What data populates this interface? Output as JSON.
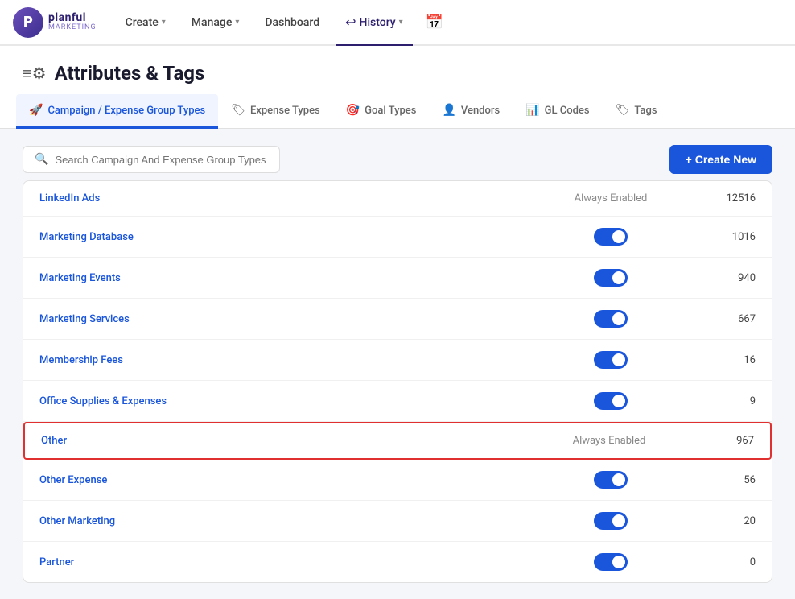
{
  "logo": {
    "initial": "P",
    "name": "planful",
    "sub": "MARKETING"
  },
  "nav": {
    "items": [
      {
        "label": "Create",
        "hasDropdown": true,
        "active": false
      },
      {
        "label": "Manage",
        "hasDropdown": true,
        "active": false
      },
      {
        "label": "Dashboard",
        "hasDropdown": false,
        "active": false
      },
      {
        "label": "History",
        "hasDropdown": true,
        "active": true
      }
    ]
  },
  "page_header": {
    "title": "Attributes & Tags",
    "icon": "⚙"
  },
  "tabs": [
    {
      "id": "campaign",
      "label": "Campaign / Expense Group Types",
      "icon": "🚀",
      "active": true
    },
    {
      "id": "expense",
      "label": "Expense Types",
      "icon": "🏷",
      "active": false
    },
    {
      "id": "goal",
      "label": "Goal Types",
      "icon": "🎯",
      "active": false
    },
    {
      "id": "vendors",
      "label": "Vendors",
      "icon": "👤",
      "active": false
    },
    {
      "id": "gl",
      "label": "GL Codes",
      "icon": "📊",
      "active": false
    },
    {
      "id": "tags",
      "label": "Tags",
      "icon": "🏷",
      "active": false
    }
  ],
  "toolbar": {
    "search_placeholder": "Search Campaign And Expense Group Types",
    "create_label": "+ Create New"
  },
  "table_rows": [
    {
      "name": "LinkedIn Ads",
      "status": "Always Enabled",
      "toggle": null,
      "count": "12516"
    },
    {
      "name": "Marketing Database",
      "status": null,
      "toggle": true,
      "count": "1016"
    },
    {
      "name": "Marketing Events",
      "status": null,
      "toggle": true,
      "count": "940"
    },
    {
      "name": "Marketing Services",
      "status": null,
      "toggle": true,
      "count": "667"
    },
    {
      "name": "Membership Fees",
      "status": null,
      "toggle": true,
      "count": "16"
    },
    {
      "name": "Office Supplies & Expenses",
      "status": null,
      "toggle": true,
      "count": "9"
    },
    {
      "name": "Other",
      "status": "Always Enabled",
      "toggle": null,
      "count": "967",
      "highlighted": true
    },
    {
      "name": "Other Expense",
      "status": null,
      "toggle": true,
      "count": "56"
    },
    {
      "name": "Other Marketing",
      "status": null,
      "toggle": true,
      "count": "20"
    },
    {
      "name": "Partner",
      "status": null,
      "toggle": true,
      "count": "0"
    }
  ]
}
